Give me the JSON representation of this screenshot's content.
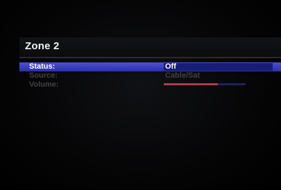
{
  "menu": {
    "title": "Zone 2",
    "rows": [
      {
        "label": "Status:",
        "value": "Off"
      },
      {
        "label": "Source:",
        "value": "Cable/Sat"
      },
      {
        "label": "Volume:",
        "level": 0.66
      }
    ]
  },
  "colors": {
    "highlight": "#3a3dc4",
    "dim_text": "#3f4046",
    "volume_fill": "#b03a52",
    "volume_track": "#1f2258"
  }
}
